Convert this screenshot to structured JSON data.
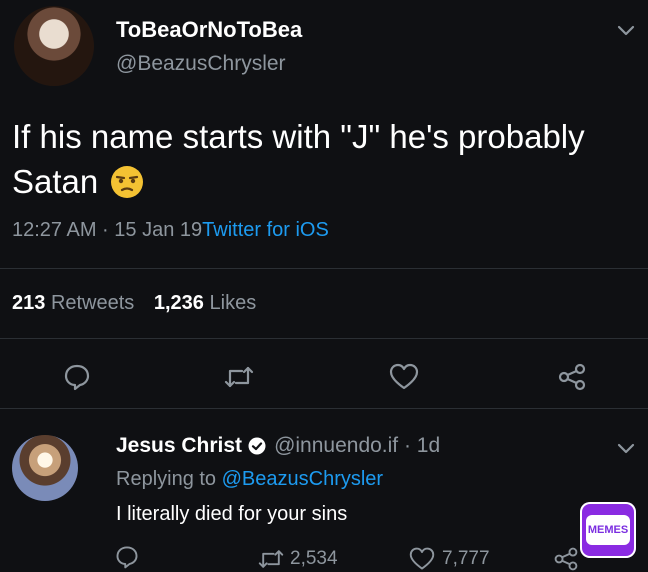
{
  "tweet": {
    "display_name": "ToBeaOrNoToBea",
    "handle": "@BeazusChrysler",
    "text_line1": "If his name starts with \"J\" he's probably",
    "text_line2": "Satan",
    "emoji": "unamused-face-emoji",
    "time": "12:27 AM · 15 Jan 19",
    "source": "Twitter for iOS",
    "retweets_count": "213",
    "retweets_label": "Retweets",
    "likes_count": "1,236",
    "likes_label": "Likes"
  },
  "reply": {
    "display_name": "Jesus Christ",
    "handle_time": "@innuendo.if · 1d",
    "replying_to_prefix": "Replying to",
    "replying_to_handle": "@BeazusChrysler",
    "text": "I literally died for your sins",
    "retweets_count": "2,534",
    "likes_count": "7,777"
  },
  "watermark": {
    "label": "MEMES"
  },
  "colors": {
    "background": "#0f1013",
    "text": "#ffffff",
    "muted": "#8e969e",
    "link": "#1d9bf0",
    "watermark": "#8a2be2"
  }
}
